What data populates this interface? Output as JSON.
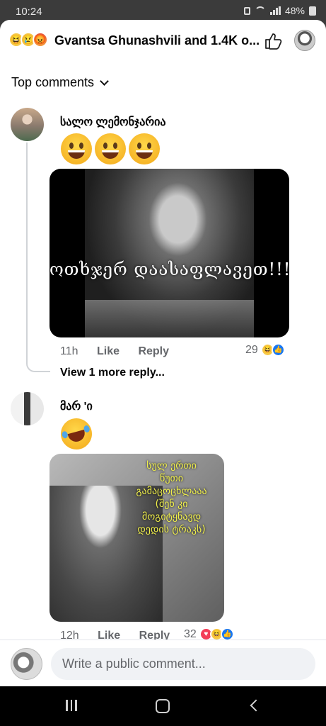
{
  "status_bar": {
    "time": "10:24",
    "battery": "48%"
  },
  "header": {
    "title": "Gvantsa Ghunashvili and 1.4K o...",
    "reaction_icons": [
      "haha-icon",
      "sad-icon",
      "angry-icon"
    ]
  },
  "sort": {
    "label": "Top comments"
  },
  "comments": [
    {
      "author": "სალო ლემონჯარია",
      "emoji_text": "😀😀😀",
      "image_caption": "ოთხჯერ დაასაფლავეთ!!!",
      "time": "11h",
      "like_label": "Like",
      "reply_label": "Reply",
      "reaction_count": "29",
      "reactions": [
        "haha",
        "like"
      ]
    },
    {
      "author": "მარ 'ი",
      "emoji_text": "🤣",
      "image_caption_lines": [
        "სულ ერთი",
        "წუთი",
        "გამაცოცხლააა",
        "(შენ კი",
        "მოგიტყნავდ",
        "დედის ტრაკს)"
      ],
      "time": "12h",
      "like_label": "Like",
      "reply_label": "Reply",
      "reaction_count": "32",
      "reactions": [
        "love",
        "haha",
        "like"
      ]
    }
  ],
  "view_more_replies": "View 1 more reply...",
  "composer": {
    "placeholder": "Write a public comment..."
  },
  "colors": {
    "like_blue": "#1877f2",
    "love_red": "#f33e58",
    "haha_yellow": "#f7c948",
    "meta_gray": "#65676b"
  }
}
